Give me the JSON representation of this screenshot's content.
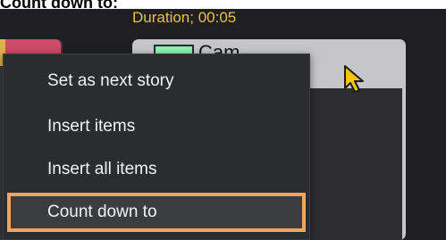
{
  "heading": "Count down to:",
  "rundown": {
    "duration_label": "Duration; 00:05",
    "camera_item_label": "Cam"
  },
  "context_menu": {
    "items": [
      {
        "label": "Set as next story"
      },
      {
        "label": "Insert items"
      },
      {
        "label": "Insert all items"
      },
      {
        "label": "Count down to",
        "highlighted": true
      }
    ]
  },
  "colors": {
    "duration_text": "#e8c24a",
    "camera_swatch": "#8ff2b2",
    "left_item_swatch": "#cd4b67",
    "highlight_border": "#f5a55a",
    "cursor": "#f2c500"
  },
  "icons": {
    "cursor": "mouse-pointer-icon"
  }
}
